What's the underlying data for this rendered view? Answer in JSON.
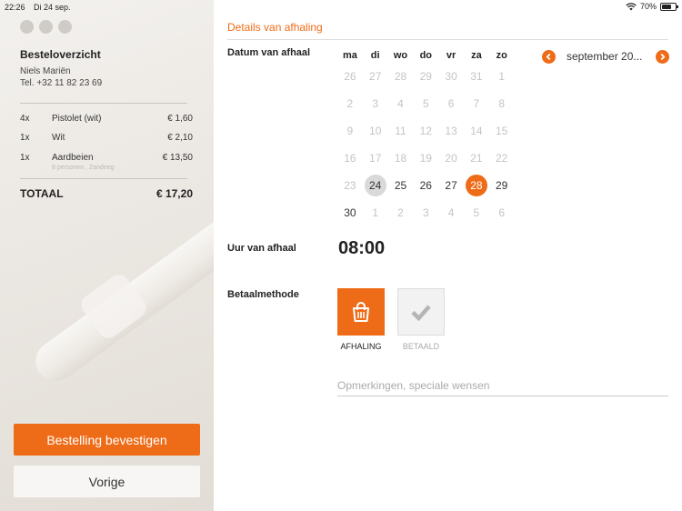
{
  "status": {
    "time": "22:26",
    "date": "Di 24 sep.",
    "battery": "70%",
    "battery_level": 0.7
  },
  "sidebar": {
    "title": "Besteloverzicht",
    "customer_name": "Niels Mariën",
    "customer_tel": "Tel. +32 11 82 23 69",
    "items": [
      {
        "qty": "4x",
        "product": "Pistolet (wit)",
        "price": "€ 1,60"
      },
      {
        "qty": "1x",
        "product": "Wit",
        "price": "€ 2,10"
      },
      {
        "qty": "1x",
        "product": "Aardbeien",
        "price": "€ 13,50",
        "sub": "8 personen , Zandeeg"
      }
    ],
    "total_label": "TOTAAL",
    "total_value": "€ 17,20",
    "confirm_button": "Bestelling bevestigen",
    "back_button": "Vorige"
  },
  "details": {
    "title": "Details van afhaling",
    "date_label": "Datum van afhaal",
    "time_label": "Uur van afhaal",
    "time_value": "08:00",
    "payment_label": "Betaalmethode",
    "payment_options": [
      {
        "label": "AFHALING",
        "icon": "shopping-bag-icon",
        "selected": true
      },
      {
        "label": "BETAALD",
        "icon": "checkmark-icon",
        "selected": false
      }
    ],
    "remarks_placeholder": "Opmerkingen, speciale wensen"
  },
  "calendar": {
    "month_label": "september 20...",
    "weekdays": [
      "ma",
      "di",
      "wo",
      "do",
      "vr",
      "za",
      "zo"
    ],
    "weeks": [
      [
        "26",
        "27",
        "28",
        "29",
        "30",
        "31",
        "1"
      ],
      [
        "2",
        "3",
        "4",
        "5",
        "6",
        "7",
        "8"
      ],
      [
        "9",
        "10",
        "11",
        "12",
        "13",
        "14",
        "15"
      ],
      [
        "16",
        "17",
        "18",
        "19",
        "20",
        "21",
        "22"
      ],
      [
        "23",
        "24",
        "25",
        "26",
        "27",
        "28",
        "29"
      ],
      [
        "30",
        "1",
        "2",
        "3",
        "4",
        "5",
        "6"
      ]
    ],
    "today": "24",
    "selected": "28"
  },
  "colors": {
    "accent": "#ee6c18",
    "today": "#d9d9d9"
  }
}
